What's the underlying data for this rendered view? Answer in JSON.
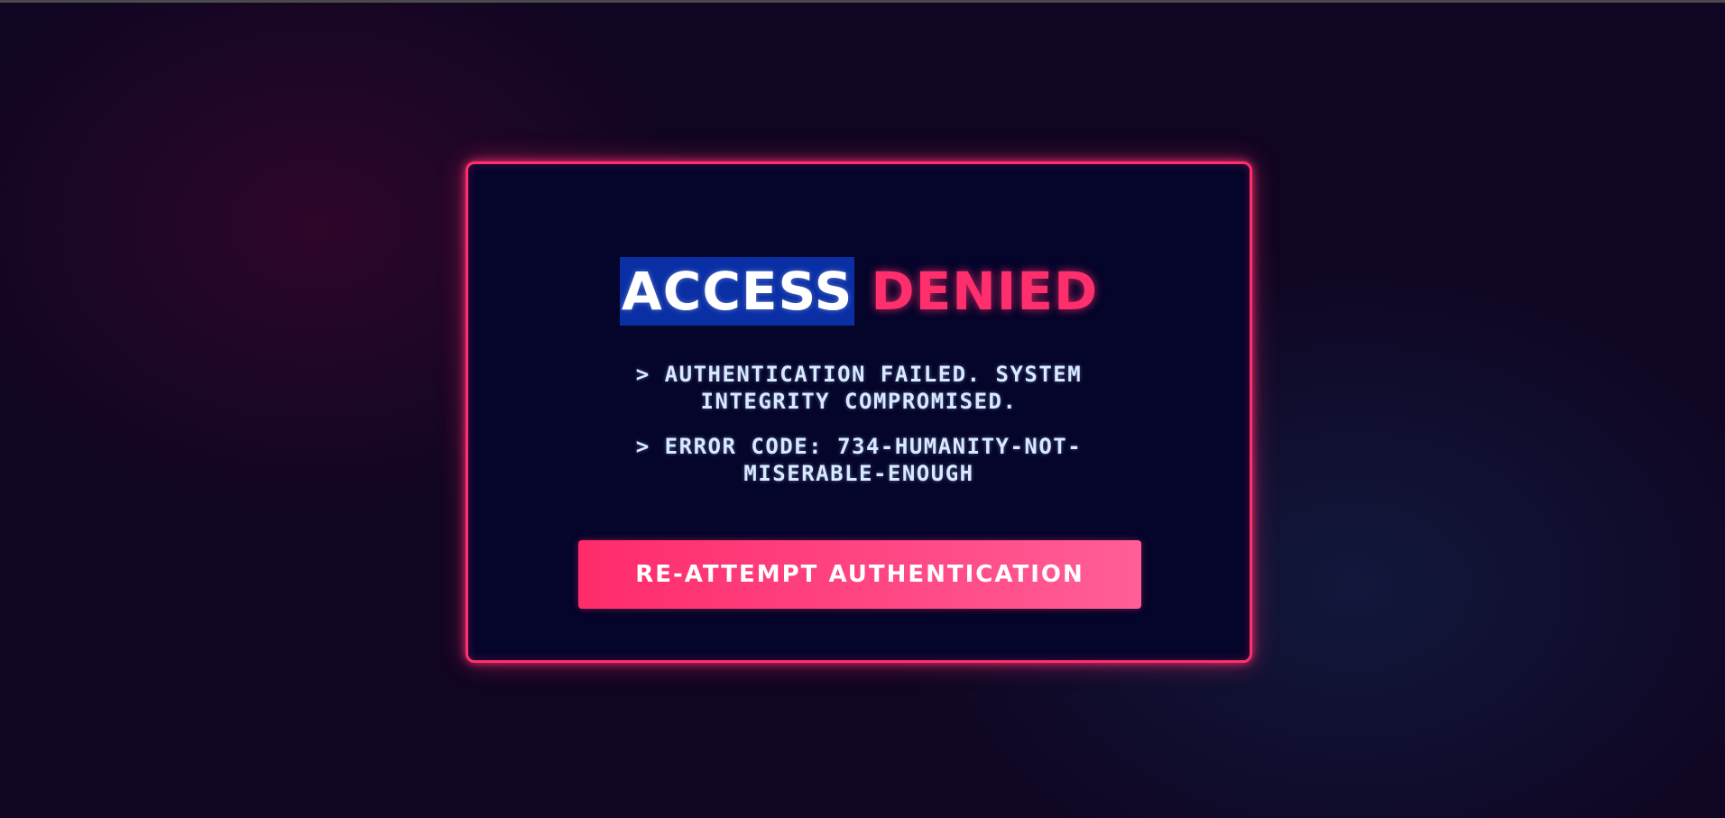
{
  "dialog": {
    "title_part1": "ACCESS",
    "title_part2": "DENIED",
    "messages": [
      "> AUTHENTICATION FAILED. SYSTEM INTEGRITY COMPROMISED.",
      "> ERROR CODE: 734-HUMANITY-NOT-MISERABLE-ENOUGH"
    ],
    "button_label": "RE-ATTEMPT AUTHENTICATION"
  },
  "colors": {
    "background": "#100522",
    "panel": "#05042a",
    "accent": "#ff2f6e",
    "selection_highlight": "#0a2fa5",
    "message_text": "#d9e9ff"
  }
}
